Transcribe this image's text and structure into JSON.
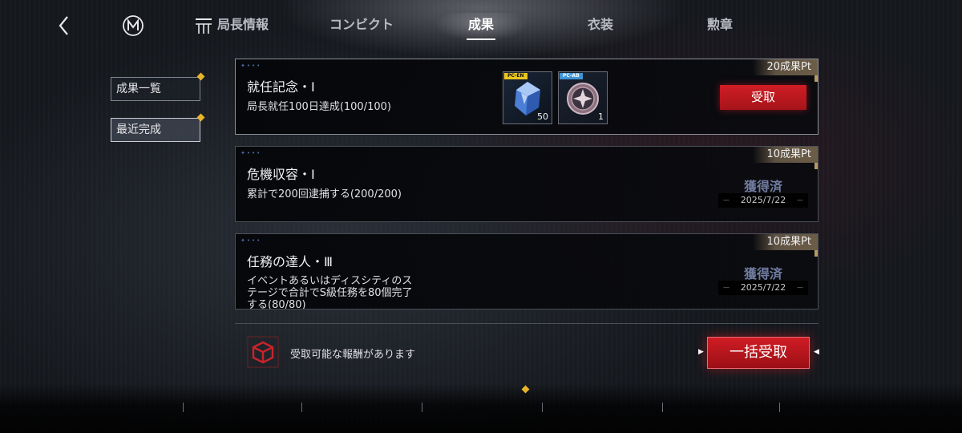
{
  "side_tabs": [
    {
      "label": "成果一覧",
      "active": false,
      "has_dot": true
    },
    {
      "label": "最近完成",
      "active": true,
      "has_dot": true
    }
  ],
  "achievements": [
    {
      "points": "20成果Pt",
      "title": "就任記念・Ⅰ",
      "desc": "局長就任100日達成(100/100)",
      "status": "claimable",
      "claim_label": "受取",
      "rewards": [
        {
          "tag": "PC-EN",
          "icon": "blue-crystal-icon",
          "qty": "50"
        },
        {
          "tag": "PC-AB",
          "icon": "badge-emblem-icon",
          "qty": "1"
        }
      ]
    },
    {
      "points": "10成果Pt",
      "title": "危機収容・Ⅰ",
      "desc": "累計で200回逮捕する(200/200)",
      "status": "obtained",
      "obtained_label": "獲得済",
      "date": "2025/7/22"
    },
    {
      "points": "10成果Pt",
      "title": "任務の達人・Ⅲ",
      "desc_lines": [
        "イベントあるいはディスシティのス",
        "テージで合計でS級任務を80個完了",
        "する(80/80)"
      ],
      "status": "obtained",
      "obtained_label": "獲得済",
      "date": "2025/7/22"
    }
  ],
  "footer": {
    "notice": "受取可能な報酬があります",
    "bulk_label": "一括受取"
  },
  "bottom_tabs": [
    {
      "label": "局長情報",
      "active": false
    },
    {
      "label": "コンビクト",
      "active": false
    },
    {
      "label": "成果",
      "active": true
    },
    {
      "label": "衣装",
      "active": false
    },
    {
      "label": "勲章",
      "active": false
    }
  ],
  "colors": {
    "accent_red": "#d11d25",
    "notify_gold": "#e8b52a",
    "obtained_blue": "#6f7c9f"
  },
  "icons": {
    "back": "back-chevron-icon",
    "logo": "m-logo-icon",
    "menu": "menu-icon",
    "notice": "red-cube-icon"
  }
}
